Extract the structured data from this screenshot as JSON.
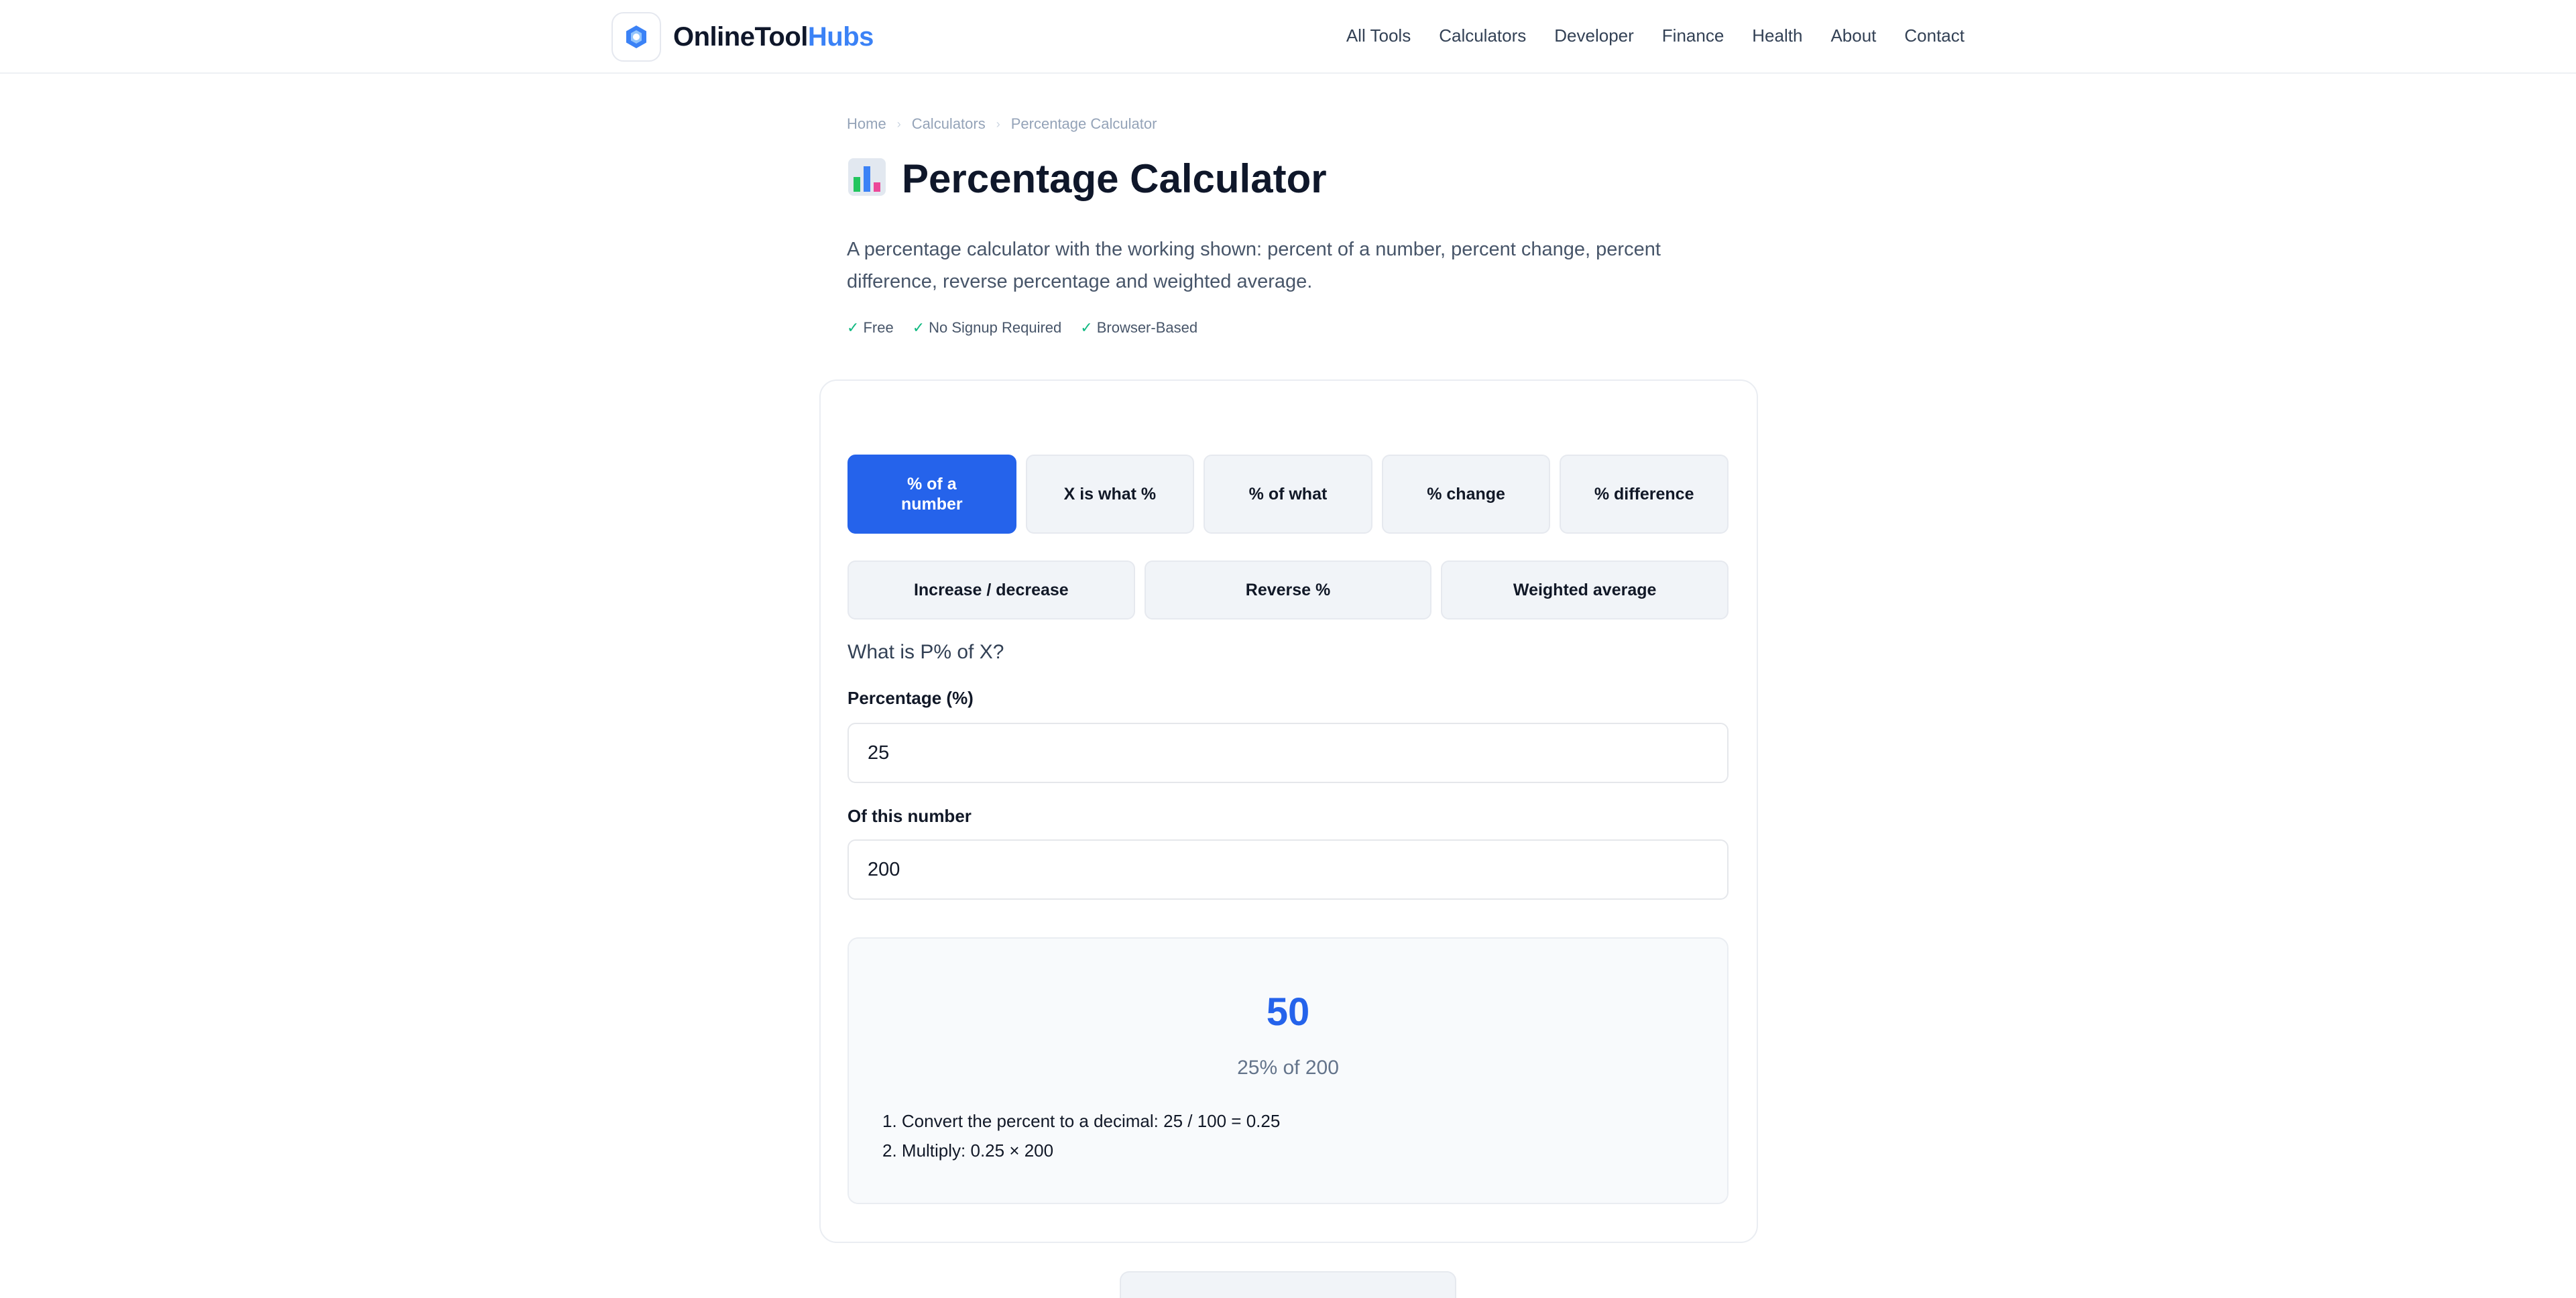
{
  "brand": {
    "name_a": "OnlineTool",
    "name_b": "Hubs",
    "colors": {
      "primary": "#2563eb",
      "brand_blue": "#3b82f6",
      "check_green": "#10b981"
    }
  },
  "nav": [
    "All Tools",
    "Calculators",
    "Developer",
    "Finance",
    "Health",
    "About",
    "Contact"
  ],
  "breadcrumb": [
    "Home",
    "Calculators",
    "Percentage Calculator"
  ],
  "page": {
    "icon": "bar-chart-icon",
    "title": "Percentage Calculator",
    "description": "A percentage calculator with the working shown: percent of a number, percent change, percent difference, reverse percentage and weighted average.",
    "badges": [
      "Free",
      "No Signup Required",
      "Browser-Based"
    ]
  },
  "tabs_row1": [
    "% of a number",
    "X is what %",
    "% of what",
    "% change",
    "% difference"
  ],
  "tabs_row2": [
    "Increase / decrease",
    "Reverse %",
    "Weighted average"
  ],
  "calculator": {
    "question": "What is P% of X?",
    "field1_label": "Percentage (%)",
    "field1_value": "25",
    "field2_label": "Of this number",
    "field2_value": "200",
    "result_value": "50",
    "result_caption": "25% of 200",
    "steps": [
      "1. Convert the percent to a decimal: 25 / 100 = 0.25",
      "2. Multiply: 0.25 × 200"
    ]
  }
}
